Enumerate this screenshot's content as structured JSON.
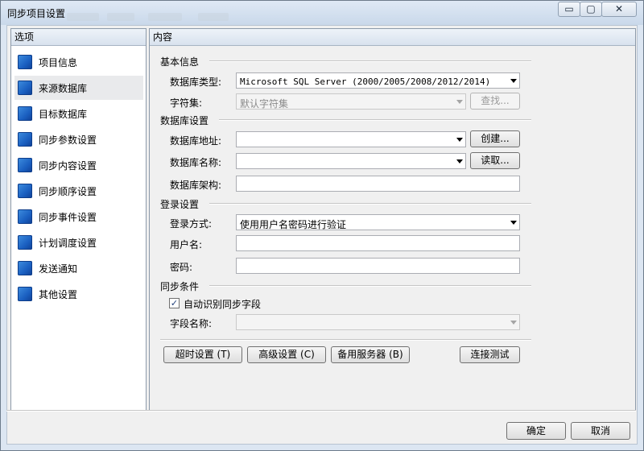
{
  "window": {
    "title": "同步项目设置",
    "controls": {
      "minimize": "▭",
      "maximize": "▢",
      "close": "✕"
    }
  },
  "left_panel": {
    "header": "选项",
    "items": [
      {
        "label": "项目信息",
        "selected": false
      },
      {
        "label": "来源数据库",
        "selected": true
      },
      {
        "label": "目标数据库",
        "selected": false
      },
      {
        "label": "同步参数设置",
        "selected": false
      },
      {
        "label": "同步内容设置",
        "selected": false
      },
      {
        "label": "同步顺序设置",
        "selected": false
      },
      {
        "label": "同步事件设置",
        "selected": false
      },
      {
        "label": "计划调度设置",
        "selected": false
      },
      {
        "label": "发送通知",
        "selected": false
      },
      {
        "label": "其他设置",
        "selected": false
      }
    ]
  },
  "content": {
    "header": "内容",
    "basic": {
      "title": "基本信息",
      "db_type_label": "数据库类型:",
      "db_type_value": "Microsoft SQL Server (2000/2005/2008/2012/2014)",
      "charset_label": "字符集:",
      "charset_value": "默认字符集",
      "lookup_button": "查找..."
    },
    "db": {
      "title": "数据库设置",
      "address_label": "数据库地址:",
      "address_value": "",
      "create_button": "创建...",
      "name_label": "数据库名称:",
      "name_value": "",
      "read_button": "读取...",
      "schema_label": "数据库架构:",
      "schema_value": ""
    },
    "login": {
      "title": "登录设置",
      "method_label": "登录方式:",
      "method_value": "使用用户名密码进行验证",
      "username_label": "用户名:",
      "username_value": "",
      "password_label": "密码:",
      "password_value": ""
    },
    "sync": {
      "title": "同步条件",
      "auto_detect_label": "自动识别同步字段",
      "auto_detect_checked": "✓",
      "field_name_label": "字段名称:",
      "field_name_value": ""
    },
    "buttons": {
      "timeout": "超时设置 (T)",
      "advanced": "高级设置 (C)",
      "backup": "备用服务器 (B)",
      "test": "连接测试"
    }
  },
  "footer": {
    "ok": "确定",
    "cancel": "取消"
  }
}
